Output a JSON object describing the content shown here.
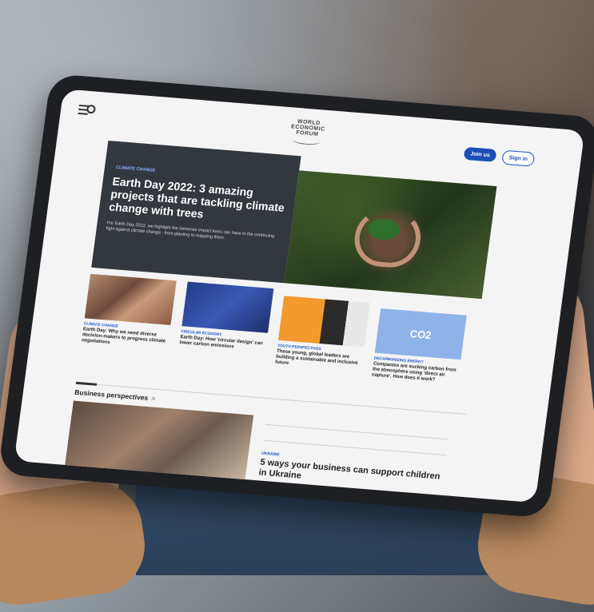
{
  "header": {
    "logo_lines": [
      "WORLD",
      "ECONOMIC",
      "FORUM"
    ],
    "join_label": "Join us",
    "signin_label": "Sign in"
  },
  "hero": {
    "category": "CLIMATE CHANGE",
    "title": "Earth Day 2022: 3 amazing projects that are tackling climate change with trees",
    "summary": "For Earth Day 2022, we highlight the immense impact trees can have in the continuing fight against climate change - from planting to mapping them."
  },
  "cards": [
    {
      "category": "CLIMATE CHANGE",
      "title": "Earth Day: Why we need diverse decision-makers to progress climate negotiations"
    },
    {
      "category": "CIRCULAR ECONOMY",
      "title": "Earth Day: How 'circular design' can lower carbon emissions"
    },
    {
      "category": "YOUTH PERSPECTIVES",
      "title": "These young, global leaders are building a sustainable and inclusive future"
    },
    {
      "category": "DECARBONIZING ENERGY",
      "title": "Companies are sucking carbon from the atmosphere using 'direct air capture'. How does it work?",
      "image_text": "CO2"
    }
  ],
  "business": {
    "section_title": "Business perspectives",
    "chevron": ">",
    "category": "UKRAINE",
    "title": "5 ways your business can support children in Ukraine"
  }
}
